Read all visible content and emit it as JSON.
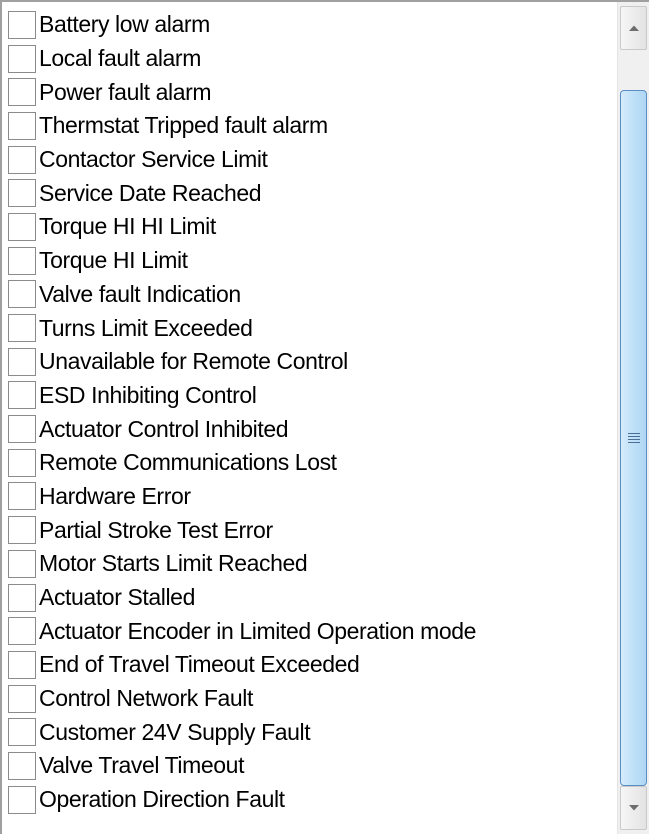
{
  "listbox": {
    "items": [
      {
        "label": "Battery low alarm",
        "checked": false
      },
      {
        "label": "Local fault alarm",
        "checked": false
      },
      {
        "label": "Power fault alarm",
        "checked": false
      },
      {
        "label": "Thermstat Tripped fault alarm",
        "checked": false
      },
      {
        "label": "Contactor Service Limit",
        "checked": false
      },
      {
        "label": "Service Date Reached",
        "checked": false
      },
      {
        "label": "Torque HI HI Limit",
        "checked": false
      },
      {
        "label": "Torque HI Limit",
        "checked": false
      },
      {
        "label": "Valve fault Indication",
        "checked": false
      },
      {
        "label": "Turns Limit Exceeded",
        "checked": false
      },
      {
        "label": "Unavailable for Remote Control",
        "checked": false
      },
      {
        "label": "ESD Inhibiting Control",
        "checked": false
      },
      {
        "label": "Actuator Control Inhibited",
        "checked": false
      },
      {
        "label": "Remote Communications Lost",
        "checked": false
      },
      {
        "label": "Hardware Error",
        "checked": false
      },
      {
        "label": "Partial Stroke Test Error",
        "checked": false
      },
      {
        "label": "Motor Starts Limit Reached",
        "checked": false
      },
      {
        "label": "Actuator Stalled",
        "checked": false
      },
      {
        "label": "Actuator Encoder in Limited Operation mode",
        "checked": false
      },
      {
        "label": "End of Travel Timeout Exceeded",
        "checked": false
      },
      {
        "label": "Control Network Fault",
        "checked": false
      },
      {
        "label": "Customer 24V Supply Fault",
        "checked": false
      },
      {
        "label": "Valve Travel Timeout",
        "checked": false
      },
      {
        "label": "Operation Direction Fault",
        "checked": false
      }
    ]
  },
  "scrollbar": {
    "up_icon": "triangle-up-icon",
    "down_icon": "triangle-down-icon",
    "grip_icon": "grip-lines-icon"
  }
}
